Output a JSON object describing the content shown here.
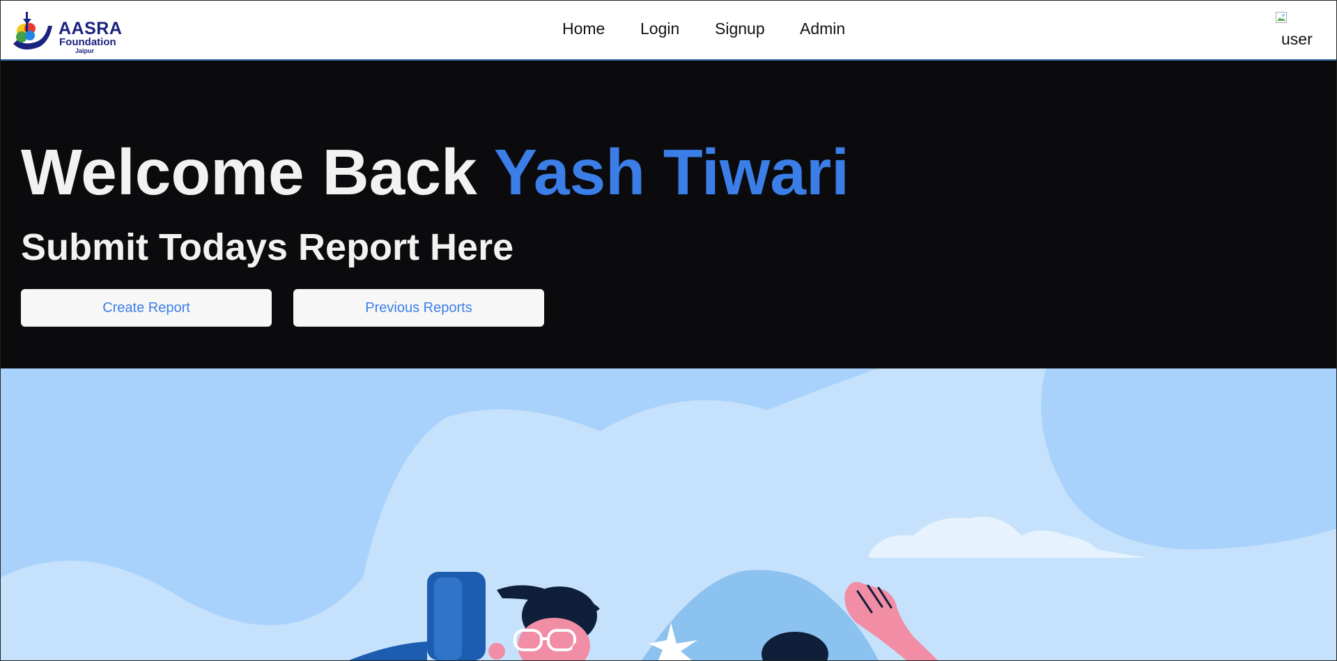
{
  "brand": {
    "name": "AASRA",
    "subtitle": "Foundation",
    "city": "Jaipur"
  },
  "nav": {
    "links": [
      "Home",
      "Login",
      "Signup",
      "Admin"
    ]
  },
  "user": {
    "avatar_alt": "user"
  },
  "hero": {
    "greeting": "Welcome Back ",
    "username": "Yash Tiwari",
    "subtitle": "Submit Todays Report Here",
    "create_button": "Create Report",
    "previous_button": "Previous Reports"
  },
  "colors": {
    "accent": "#3b7ee8",
    "hero_bg": "#0b0b0d",
    "illustration_sky": "#a8d2fb",
    "brand_navy": "#1a237e"
  },
  "icons": {
    "logo": "aasra-foundation-logo",
    "broken_image": "broken-image-icon"
  }
}
